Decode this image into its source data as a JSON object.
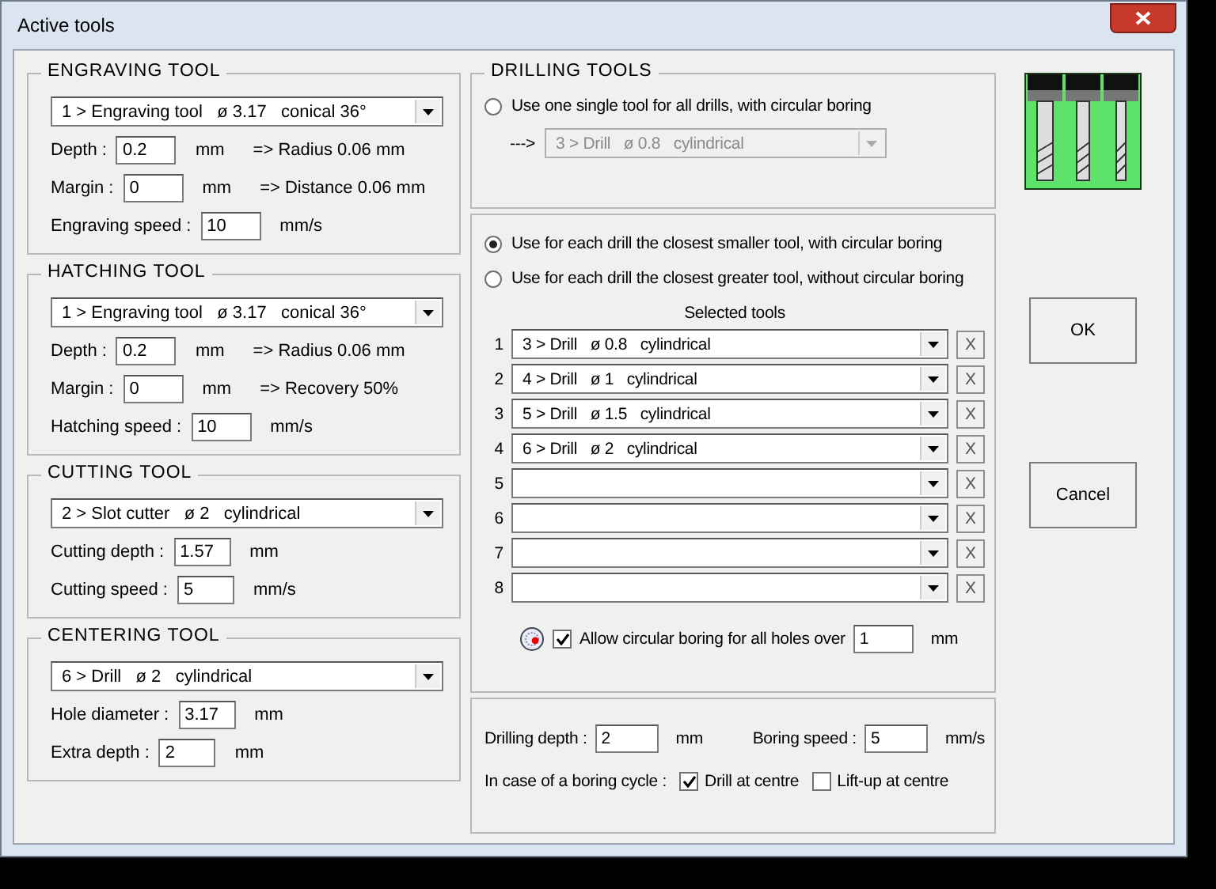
{
  "window": {
    "title": "Active tools"
  },
  "left_groups": [
    {
      "title": "ENGRAVING TOOL",
      "tool": "1 > Engraving tool   ø 3.17   conical 36°",
      "fields": [
        {
          "label": "Depth :",
          "value": "0.2",
          "unit": "mm",
          "note": "=> Radius 0.06 mm"
        },
        {
          "label": "Margin :",
          "value": "0",
          "unit": "mm",
          "note": "=> Distance 0.06 mm"
        },
        {
          "label": "Engraving speed :",
          "value": "10",
          "unit": "mm/s"
        }
      ]
    },
    {
      "title": "HATCHING TOOL",
      "tool": "1 > Engraving tool   ø 3.17   conical 36°",
      "fields": [
        {
          "label": "Depth :",
          "value": "0.2",
          "unit": "mm",
          "note": "=> Radius 0.06 mm"
        },
        {
          "label": "Margin :",
          "value": "0",
          "unit": "mm",
          "note": "=> Recovery 50%"
        },
        {
          "label": "Hatching speed :",
          "value": "10",
          "unit": "mm/s"
        }
      ]
    },
    {
      "title": "CUTTING TOOL",
      "tool": "2 > Slot cutter   ø 2   cylindrical",
      "fields": [
        {
          "label": "Cutting depth :",
          "value": "1.57",
          "unit": "mm"
        },
        {
          "label": "Cutting speed :",
          "value": "5",
          "unit": "mm/s"
        }
      ]
    },
    {
      "title": "CENTERING TOOL",
      "tool": "6 > Drill   ø 2   cylindrical",
      "fields": [
        {
          "label": "Hole diameter :",
          "value": "3.17",
          "unit": "mm"
        },
        {
          "label": "Extra depth :",
          "value": "2",
          "unit": "mm"
        }
      ]
    }
  ],
  "drilling": {
    "title": "DRILLING TOOLS",
    "single": {
      "label": "Use one single tool for all drills, with circular boring",
      "selected": false,
      "arrow": "--->",
      "tool": "3 > Drill   ø 0.8   cylindrical",
      "disabled": true
    },
    "options": [
      {
        "label": "Use for each drill the closest smaller tool, with circular boring",
        "selected": true
      },
      {
        "label": "Use for each drill the closest greater tool, without circular boring",
        "selected": false
      }
    ],
    "selected_tools_heading": "Selected tools",
    "selected_tools": [
      {
        "number": "1",
        "tool": "3 > Drill   ø 0.8   cylindrical",
        "remove": "X"
      },
      {
        "number": "2",
        "tool": "4 > Drill   ø 1   cylindrical",
        "remove": "X"
      },
      {
        "number": "3",
        "tool": "5 > Drill   ø 1.5   cylindrical",
        "remove": "X"
      },
      {
        "number": "4",
        "tool": "6 > Drill   ø 2   cylindrical",
        "remove": "X"
      },
      {
        "number": "5",
        "remove": "X"
      },
      {
        "number": "6",
        "remove": "X"
      },
      {
        "number": "7",
        "remove": "X"
      },
      {
        "number": "8",
        "remove": "X"
      }
    ],
    "circular_boring": {
      "label": "Allow circular boring for all holes over",
      "checked": true,
      "value": "1",
      "unit": "mm"
    },
    "drilling_depth": {
      "label": "Drilling depth :",
      "value": "2",
      "unit": "mm"
    },
    "boring_speed": {
      "label": "Boring speed :",
      "value": "5",
      "unit": "mm/s"
    },
    "boring_cycle": {
      "label": "In case of a boring cycle :",
      "checks": [
        {
          "label": "Drill at centre",
          "checked": true
        },
        {
          "label": "Lift-up at centre",
          "checked": false
        }
      ]
    }
  },
  "buttons": [
    "OK",
    "Cancel"
  ]
}
